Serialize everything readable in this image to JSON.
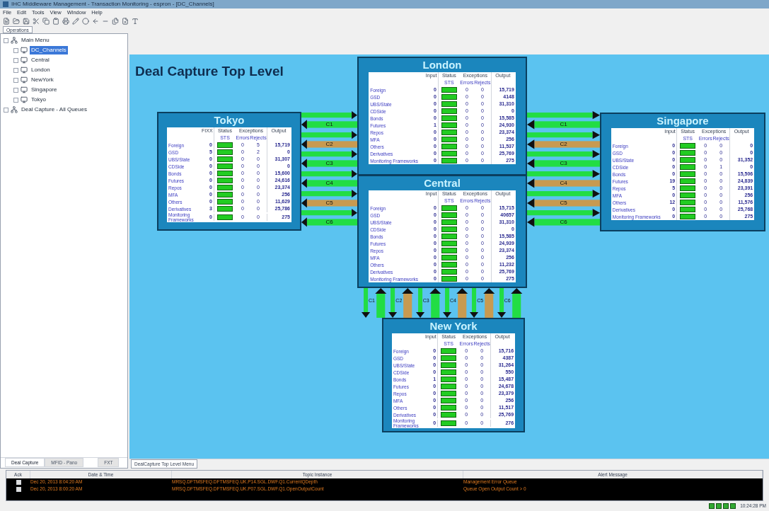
{
  "window": {
    "title": "IHC Middleware Management - Transaction Monitoring - espron - [DC_Channels]"
  },
  "menu": [
    "File",
    "Edit",
    "Tools",
    "View",
    "Window",
    "Help"
  ],
  "sidebar": {
    "tab": "Operations",
    "tree": [
      {
        "label": "Main Menu",
        "selected": false,
        "children": [
          {
            "label": "DC_Channels",
            "selected": true
          },
          {
            "label": "Central",
            "selected": false
          },
          {
            "label": "London",
            "selected": false
          },
          {
            "label": "NewYork",
            "selected": false
          },
          {
            "label": "Singapore",
            "selected": false
          },
          {
            "label": "Tokyo",
            "selected": false
          }
        ]
      },
      {
        "label": "Deal Capture - All Queues",
        "selected": false
      }
    ],
    "bottom_tabs": [
      {
        "label": "Deal Capture",
        "selected": true
      },
      {
        "label": "MFID - Pano",
        "selected": false
      },
      {
        "label": "FXT",
        "selected": false
      }
    ]
  },
  "canvas": {
    "title": "Deal Capture Top Level",
    "tab": "DealCapture Top Level Menu",
    "panels": [
      {
        "name": "London",
        "headers": {
          "input": "Input",
          "status": "Status",
          "sts": "STS",
          "exceptions": "Exceptions",
          "errors": "Errors",
          "rejects": "Rejects",
          "output": "Output"
        },
        "rows": [
          {
            "label": "Foreign",
            "input": "0",
            "ok": true,
            "errors": "0",
            "rejects": "0",
            "output": "15,719"
          },
          {
            "label": "GSD",
            "input": "0",
            "ok": true,
            "errors": "0",
            "rejects": "0",
            "output": "4148"
          },
          {
            "label": "UBS/State",
            "input": "0",
            "ok": true,
            "errors": "0",
            "rejects": "0",
            "output": "31,310"
          },
          {
            "label": "CDSide",
            "input": "0",
            "ok": true,
            "errors": "0",
            "rejects": "0",
            "output": "0"
          },
          {
            "label": "Bonds",
            "input": "0",
            "ok": true,
            "errors": "0",
            "rejects": "0",
            "output": "15,585"
          },
          {
            "label": "Futures",
            "input": "1",
            "ok": true,
            "errors": "0",
            "rejects": "0",
            "output": "24,930"
          },
          {
            "label": "Repos",
            "input": "0",
            "ok": true,
            "errors": "0",
            "rejects": "0",
            "output": "23,374"
          },
          {
            "label": "MFA",
            "input": "0",
            "ok": true,
            "errors": "0",
            "rejects": "0",
            "output": "256"
          },
          {
            "label": "Others",
            "input": "0",
            "ok": true,
            "errors": "0",
            "rejects": "0",
            "output": "11,537"
          },
          {
            "label": "Derivatives",
            "input": "0",
            "ok": true,
            "errors": "0",
            "rejects": "0",
            "output": "25,769"
          },
          {
            "label": "Monitoring Frameworks",
            "input": "0",
            "ok": true,
            "errors": "0",
            "rejects": "0",
            "output": "275"
          }
        ]
      },
      {
        "name": "Tokyo",
        "headers": {
          "input": "FIXX",
          "status": "Status",
          "sts": "STS",
          "exceptions": "Exceptions",
          "errors": "Errors",
          "rejects": "Rejects",
          "output": "Output"
        },
        "rows": [
          {
            "label": "Foreign",
            "input": "0",
            "ok": true,
            "errors": "0",
            "rejects": "5",
            "output": "15,719"
          },
          {
            "label": "GSD",
            "input": "5",
            "ok": true,
            "errors": "0",
            "rejects": "2",
            "output": "0"
          },
          {
            "label": "UBS/State",
            "input": "0",
            "ok": true,
            "errors": "0",
            "rejects": "0",
            "output": "31,307"
          },
          {
            "label": "CDSide",
            "input": "0",
            "ok": true,
            "errors": "0",
            "rejects": "0",
            "output": "0"
          },
          {
            "label": "Bonds",
            "input": "0",
            "ok": true,
            "errors": "0",
            "rejects": "0",
            "output": "15,600"
          },
          {
            "label": "Futures",
            "input": "0",
            "ok": true,
            "errors": "0",
            "rejects": "0",
            "output": "24,616"
          },
          {
            "label": "Repos",
            "input": "0",
            "ok": true,
            "errors": "0",
            "rejects": "0",
            "output": "23,374"
          },
          {
            "label": "MFA",
            "input": "0",
            "ok": true,
            "errors": "0",
            "rejects": "0",
            "output": "256"
          },
          {
            "label": "Others",
            "input": "0",
            "ok": true,
            "errors": "0",
            "rejects": "0",
            "output": "11,629"
          },
          {
            "label": "Derivatives",
            "input": "3",
            "ok": true,
            "errors": "0",
            "rejects": "0",
            "output": "25,786"
          },
          {
            "label": "Monitoring Frameworks",
            "input": "0",
            "ok": true,
            "errors": "0",
            "rejects": "0",
            "output": "275"
          }
        ]
      },
      {
        "name": "Central",
        "headers": {
          "input": "Input",
          "status": "Status",
          "sts": "STS",
          "exceptions": "Exceptions",
          "errors": "Errors",
          "rejects": "Rejects",
          "output": "Output"
        },
        "rows": [
          {
            "label": "Foreign",
            "input": "0",
            "ok": true,
            "errors": "0",
            "rejects": "0",
            "output": "15,715"
          },
          {
            "label": "GSD",
            "input": "0",
            "ok": true,
            "errors": "0",
            "rejects": "0",
            "output": "40657"
          },
          {
            "label": "UBS/State",
            "input": "0",
            "ok": true,
            "errors": "0",
            "rejects": "0",
            "output": "31,310"
          },
          {
            "label": "CDSide",
            "input": "0",
            "ok": true,
            "errors": "0",
            "rejects": "0",
            "output": "0"
          },
          {
            "label": "Bonds",
            "input": "0",
            "ok": true,
            "errors": "0",
            "rejects": "0",
            "output": "15,585"
          },
          {
            "label": "Futures",
            "input": "0",
            "ok": true,
            "errors": "0",
            "rejects": "0",
            "output": "24,939"
          },
          {
            "label": "Repos",
            "input": "0",
            "ok": true,
            "errors": "0",
            "rejects": "0",
            "output": "23,374"
          },
          {
            "label": "MFA",
            "input": "0",
            "ok": true,
            "errors": "0",
            "rejects": "0",
            "output": "256"
          },
          {
            "label": "Others",
            "input": "0",
            "ok": true,
            "errors": "0",
            "rejects": "0",
            "output": "11,232"
          },
          {
            "label": "Derivatives",
            "input": "0",
            "ok": true,
            "errors": "0",
            "rejects": "0",
            "output": "25,769"
          },
          {
            "label": "Monitoring Frameworks",
            "input": "0",
            "ok": true,
            "errors": "0",
            "rejects": "0",
            "output": "275"
          }
        ]
      },
      {
        "name": "Singapore",
        "headers": {
          "input": "Input",
          "status": "Status",
          "sts": "STS",
          "exceptions": "Exceptions",
          "errors": "Errors",
          "rejects": "Rejects",
          "output": "Output"
        },
        "rows": [
          {
            "label": "Foreign",
            "input": "0",
            "ok": true,
            "errors": "0",
            "rejects": "0",
            "output": "0"
          },
          {
            "label": "GSD",
            "input": "0",
            "ok": true,
            "errors": "0",
            "rejects": "0",
            "output": "0"
          },
          {
            "label": "UBS/State",
            "input": "0",
            "ok": true,
            "errors": "0",
            "rejects": "0",
            "output": "31,352"
          },
          {
            "label": "CDSide",
            "input": "0",
            "ok": true,
            "errors": "0",
            "rejects": "1",
            "output": "0"
          },
          {
            "label": "Bonds",
            "input": "0",
            "ok": true,
            "errors": "0",
            "rejects": "0",
            "output": "15,506"
          },
          {
            "label": "Futures",
            "input": "19",
            "ok": true,
            "errors": "0",
            "rejects": "0",
            "output": "24,839"
          },
          {
            "label": "Repos",
            "input": "5",
            "ok": true,
            "errors": "0",
            "rejects": "0",
            "output": "23,391"
          },
          {
            "label": "MFA",
            "input": "0",
            "ok": true,
            "errors": "0",
            "rejects": "0",
            "output": "256"
          },
          {
            "label": "Others",
            "input": "12",
            "ok": true,
            "errors": "0",
            "rejects": "0",
            "output": "11,576"
          },
          {
            "label": "Derivatives",
            "input": "0",
            "ok": true,
            "errors": "0",
            "rejects": "0",
            "output": "25,768"
          },
          {
            "label": "Monitoring Frameworks",
            "input": "0",
            "ok": true,
            "errors": "0",
            "rejects": "0",
            "output": "275"
          }
        ]
      },
      {
        "name": "New York",
        "headers": {
          "input": "Input",
          "status": "Status",
          "sts": "STS",
          "exceptions": "Exceptions",
          "errors": "Errors",
          "rejects": "Rejects",
          "output": "Output"
        },
        "rows": [
          {
            "label": "Foreign",
            "input": "0",
            "ok": true,
            "errors": "0",
            "rejects": "0",
            "output": "15,716"
          },
          {
            "label": "GSD",
            "input": "0",
            "ok": true,
            "errors": "0",
            "rejects": "0",
            "output": "4387"
          },
          {
            "label": "UBS/State",
            "input": "0",
            "ok": true,
            "errors": "0",
            "rejects": "0",
            "output": "31,264"
          },
          {
            "label": "CDSide",
            "input": "0",
            "ok": true,
            "errors": "0",
            "rejects": "0",
            "output": "550"
          },
          {
            "label": "Bonds",
            "input": "1",
            "ok": true,
            "errors": "0",
            "rejects": "0",
            "output": "15,487"
          },
          {
            "label": "Futures",
            "input": "0",
            "ok": true,
            "errors": "0",
            "rejects": "0",
            "output": "24,678"
          },
          {
            "label": "Repos",
            "input": "0",
            "ok": true,
            "errors": "0",
            "rejects": "0",
            "output": "23,379"
          },
          {
            "label": "MFA",
            "input": "0",
            "ok": true,
            "errors": "0",
            "rejects": "0",
            "output": "256"
          },
          {
            "label": "Others",
            "input": "0",
            "ok": true,
            "errors": "0",
            "rejects": "0",
            "output": "11,517"
          },
          {
            "label": "Derivatives",
            "input": "0",
            "ok": true,
            "errors": "0",
            "rejects": "0",
            "output": "25,769"
          },
          {
            "label": "Monitoring Frameworks",
            "input": "0",
            "ok": true,
            "errors": "0",
            "rejects": "0",
            "output": "276"
          }
        ]
      }
    ],
    "links": [
      {
        "kind": "horizontal",
        "channels": [
          {
            "label": "C1",
            "color": "#22dd44"
          },
          {
            "label": "C2",
            "color": "#c89a50"
          },
          {
            "label": "C3",
            "color": "#22dd44"
          },
          {
            "label": "C4",
            "color": "#22dd44"
          },
          {
            "label": "C5",
            "color": "#c89a50"
          },
          {
            "label": "C6",
            "color": "#22dd44"
          }
        ]
      },
      {
        "kind": "horizontal",
        "channels": [
          {
            "label": "C1",
            "color": "#22dd44"
          },
          {
            "label": "C2",
            "color": "#c89a50"
          },
          {
            "label": "C3",
            "color": "#22dd44"
          },
          {
            "label": "C4",
            "color": "#c89a50"
          },
          {
            "label": "C5",
            "color": "#c89a50"
          },
          {
            "label": "C6",
            "color": "#22dd44"
          }
        ]
      },
      {
        "kind": "vertical",
        "channels": [
          {
            "label": "C1",
            "color": "#22dd44"
          },
          {
            "label": "C2",
            "color": "#c89a50"
          },
          {
            "label": "C3",
            "color": "#22dd44"
          },
          {
            "label": "C4",
            "color": "#c89a50"
          },
          {
            "label": "C5",
            "color": "#c89a50"
          },
          {
            "label": "C6",
            "color": "#22dd44"
          }
        ]
      }
    ]
  },
  "alerts": {
    "columns": [
      "Ack",
      "Date & Time",
      "Topic Instance",
      "Alert Message"
    ],
    "rows": [
      {
        "acked": true,
        "time": "Dec 20, 2013 8:04:20 AM",
        "topic": "MRSQ.DFTMSFEQ.DFTMSFEQ.UK.P14.SGL.DWF.Q1.CurrentQDepth",
        "message": "Management Error Queue"
      },
      {
        "acked": true,
        "time": "Dec 20, 2013 8:00:20 AM",
        "topic": "MRSQ.DFTMSFEQ.DFTMSFEQ.UK.P07.SGL.DWF.Q1.OpenOutputCount",
        "message": "Queue Open Output Count > 0"
      }
    ]
  },
  "status_bar": {
    "time": "10:24:28 PM"
  }
}
